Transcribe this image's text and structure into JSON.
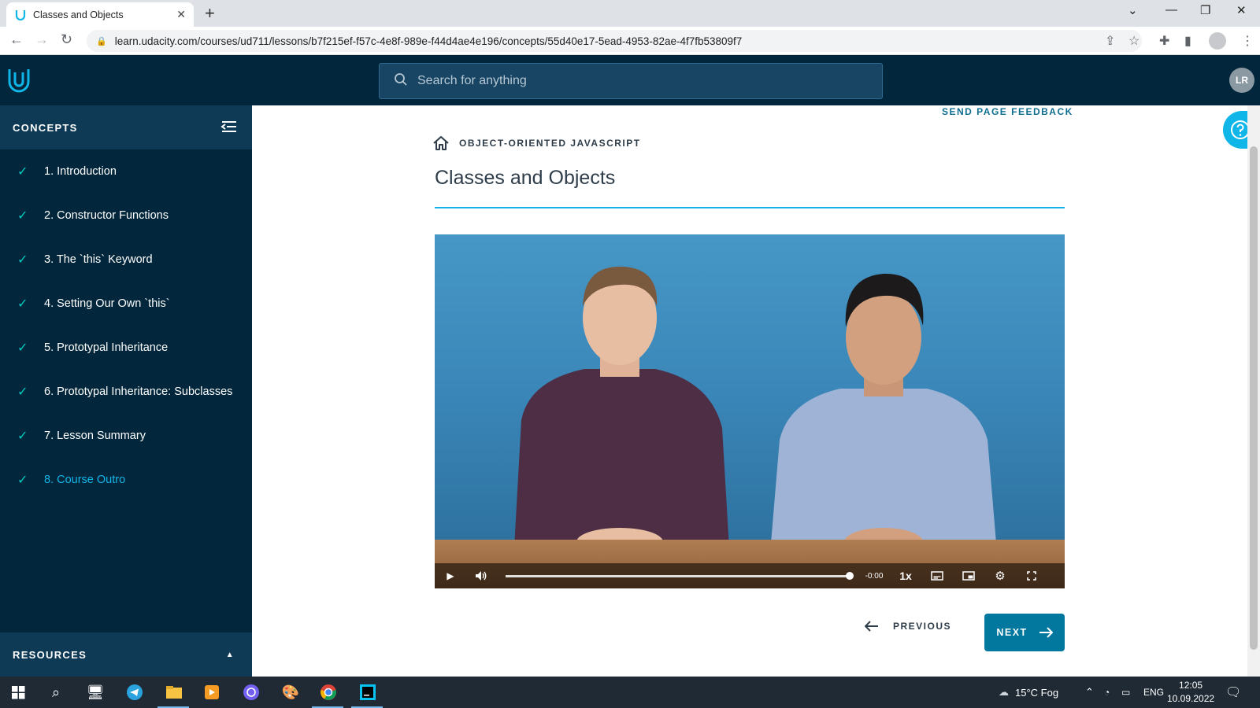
{
  "browser": {
    "tab_title": "Classes and Objects",
    "url": "learn.udacity.com/courses/ud711/lessons/b7f215ef-f57c-4e8f-989e-f44d4ae4e196/concepts/55d40e17-5ead-4953-82ae-4f7fb53809f7"
  },
  "header": {
    "search_placeholder": "Search for anything",
    "avatar_initials": "LR"
  },
  "sidebar": {
    "title": "CONCEPTS",
    "items": [
      {
        "label": "1. Introduction",
        "done": true
      },
      {
        "label": "2. Constructor Functions",
        "done": true
      },
      {
        "label": "3. The `this` Keyword",
        "done": true
      },
      {
        "label": "4. Setting Our Own `this`",
        "done": true
      },
      {
        "label": "5. Prototypal Inheritance",
        "done": true
      },
      {
        "label": "6. Prototypal Inheritance: Subclasses",
        "done": true
      },
      {
        "label": "7. Lesson Summary",
        "done": true
      },
      {
        "label": "8. Course Outro",
        "done": true,
        "active": true
      }
    ],
    "resources_label": "RESOURCES"
  },
  "main": {
    "feedback_label": "SEND PAGE FEEDBACK",
    "breadcrumb": "OBJECT-ORIENTED JAVASCRIPT",
    "title": "Classes and Objects",
    "video": {
      "time_remaining": "-0:00",
      "speed": "1x",
      "progress": 1.0
    },
    "prev_label": "PREVIOUS",
    "next_label": "NEXT"
  },
  "taskbar": {
    "weather": "15°C  Fog",
    "language": "ENG",
    "time": "12:05",
    "date": "10.09.2022"
  },
  "colors": {
    "navy": "#02263b",
    "accent": "#11b6e8",
    "check": "#02ccba",
    "next_button": "#02789e"
  }
}
